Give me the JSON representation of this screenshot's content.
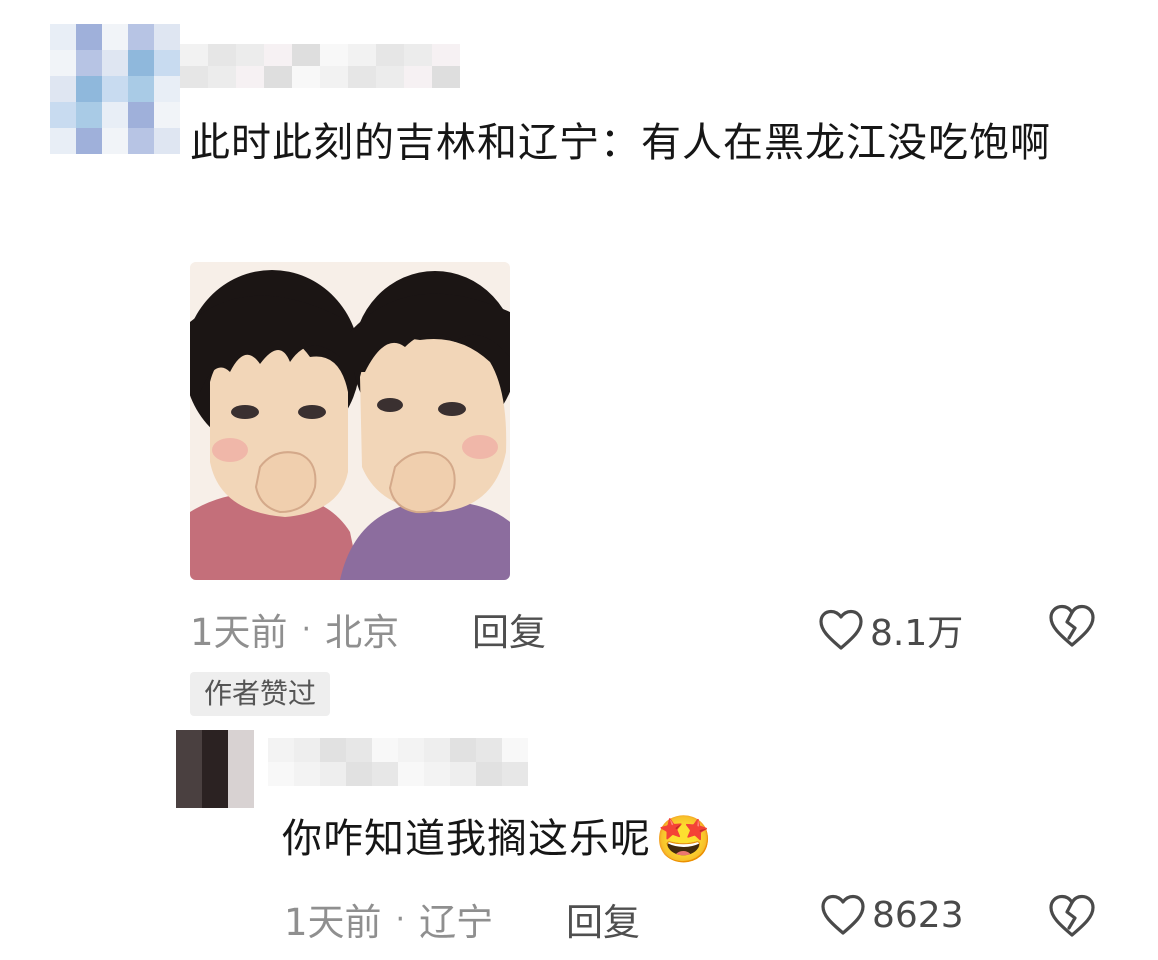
{
  "comments": [
    {
      "text": "此时此刻的吉林和辽宁：有人在黑龙江没吃饱啊",
      "has_image": true,
      "time": "1天前",
      "location": "北京",
      "reply_label": "回复",
      "likes": "8.1万",
      "author_liked_badge": "作者赞过"
    },
    {
      "text": "你咋知道我搁这乐呢",
      "emoji": "🤩",
      "time": "1天前",
      "location": "辽宁",
      "reply_label": "回复",
      "likes": "8623"
    }
  ],
  "meta_separator": "·",
  "icons": {
    "like": "heart-outline-icon",
    "dislike": "broken-heart-icon"
  }
}
